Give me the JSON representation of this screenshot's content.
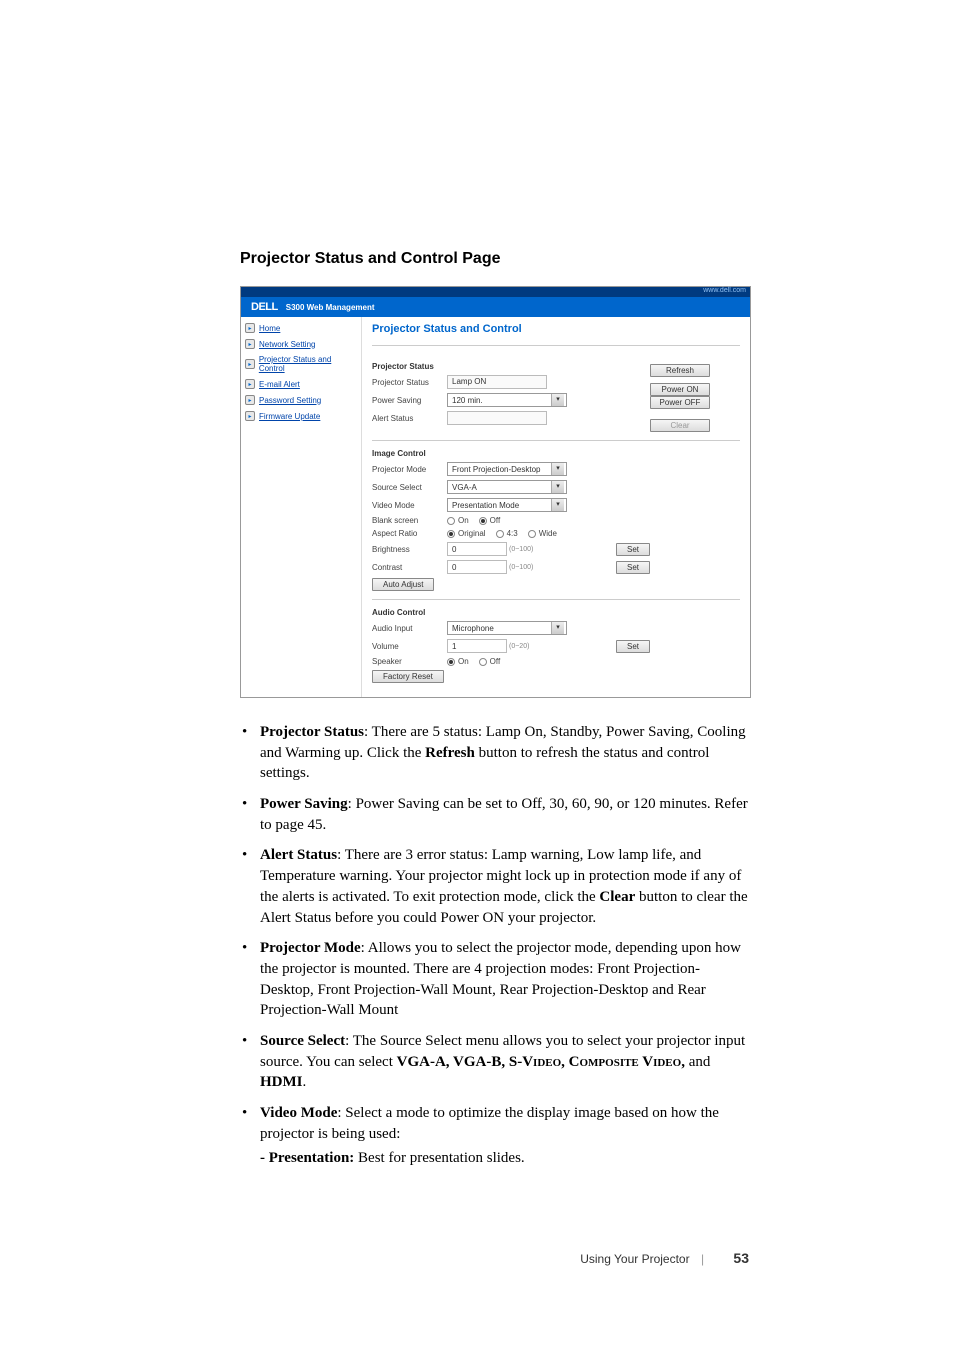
{
  "section_title": "Projector Status and Control Page",
  "screenshot": {
    "top_link": "www.dell.com",
    "logo": "DELL",
    "header_sub": "S300 Web Management",
    "sidebar": {
      "items": [
        {
          "label": "Home"
        },
        {
          "label": "Network Setting"
        },
        {
          "label": "Projector Status and Control"
        },
        {
          "label": "E-mail Alert"
        },
        {
          "label": "Password Setting"
        },
        {
          "label": "Firmware Update"
        }
      ]
    },
    "main_title": "Projector Status and Control",
    "status": {
      "head": "Projector Status",
      "projector_status_label": "Projector Status",
      "projector_status_value": "Lamp ON",
      "power_saving_label": "Power Saving",
      "power_saving_value": "120 min.",
      "alert_status_label": "Alert Status",
      "alert_status_value": "",
      "btn_refresh": "Refresh",
      "btn_power_on": "Power ON",
      "btn_power_off": "Power OFF",
      "btn_clear": "Clear"
    },
    "image_control": {
      "head": "Image Control",
      "projector_mode_label": "Projector Mode",
      "projector_mode_value": "Front Projection-Desktop",
      "source_select_label": "Source Select",
      "source_select_value": "VGA-A",
      "video_mode_label": "Video Mode",
      "video_mode_value": "Presentation Mode",
      "blank_screen_label": "Blank screen",
      "blank_on": "On",
      "blank_off": "Off",
      "aspect_label": "Aspect Ratio",
      "aspect_original": "Original",
      "aspect_43": "4:3",
      "aspect_wide": "Wide",
      "brightness_label": "Brightness",
      "brightness_value": "0",
      "brightness_range": "(0~100)",
      "contrast_label": "Contrast",
      "contrast_value": "0",
      "contrast_range": "(0~100)",
      "btn_set": "Set",
      "btn_auto_adjust": "Auto Adjust"
    },
    "audio_control": {
      "head": "Audio Control",
      "audio_input_label": "Audio Input",
      "audio_input_value": "Microphone",
      "volume_label": "Volume",
      "volume_value": "1",
      "volume_range": "(0~20)",
      "speaker_label": "Speaker",
      "speaker_on": "On",
      "speaker_off": "Off",
      "btn_set": "Set",
      "btn_factory_reset": "Factory Reset"
    }
  },
  "bullets": [
    {
      "lead": "Projector Status",
      "text": ": There are 5 status: Lamp On, Standby, Power Saving, Cooling and Warming up. Click the ",
      "bold1": "Refresh",
      "text2": " button to refresh the status and control settings."
    },
    {
      "lead": "Power Saving",
      "text": ": Power Saving can be set to Off, 30, 60, 90, or 120 minutes. Refer to page 45."
    },
    {
      "lead": "Alert Status",
      "text": ": There are 3 error status: Lamp warning, Low lamp life, and Temperature warning. Your projector might lock up in protection mode if any of the alerts is activated. To exit protection mode, click the ",
      "bold1": "Clear",
      "text2": " button to clear the Alert Status before you could Power ON your projector."
    },
    {
      "lead": "Projector Mode",
      "text": ": Allows you to select the projector mode, depending upon how the projector is mounted. There are 4 projection modes: Front Projection-Desktop, Front Projection-Wall Mount, Rear Projection-Desktop and Rear Projection-Wall Mount"
    },
    {
      "lead": "Source Select",
      "text": ": The Source Select menu allows you to select your projector input source. You can select ",
      "sources": "VGA-A, VGA-B, S-Video, Composite Video,",
      "andword": " and ",
      "hdmi": "HDMI",
      "tail": "."
    },
    {
      "lead": "Video Mode",
      "text": ": Select a mode to optimize the display image based on how the projector is being used:",
      "subhead": "- Presentation:",
      "subtext": " Best for presentation slides."
    }
  ],
  "footer": {
    "chapter": "Using Your Projector",
    "page": "53"
  }
}
